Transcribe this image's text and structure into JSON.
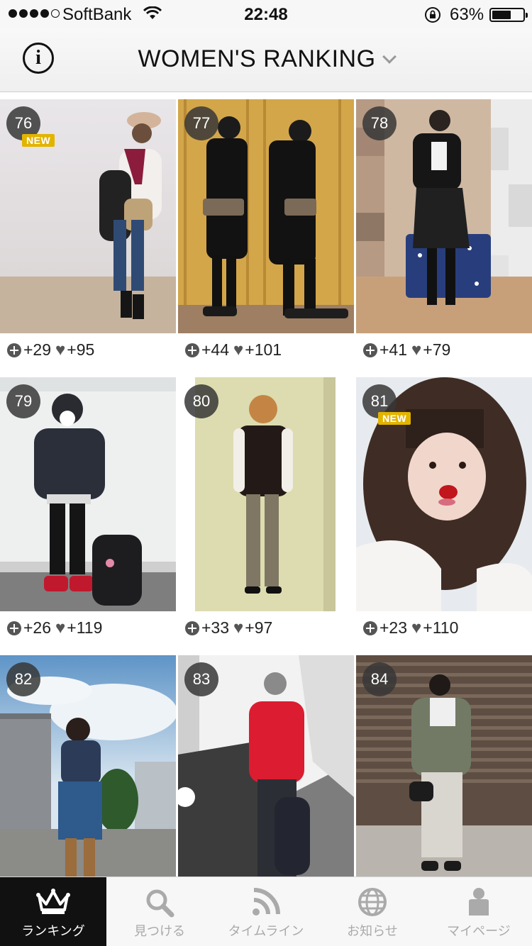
{
  "status_bar": {
    "carrier": "SoftBank",
    "time": "22:48",
    "battery": "63%",
    "battery_level": 0.63
  },
  "header": {
    "title": "WOMEN'S RANKING",
    "info_icon": "info-icon",
    "dropdown_icon": "chevron-down-icon"
  },
  "ranking": [
    {
      "rank": "76",
      "new": "NEW",
      "clips": "+29",
      "likes": "+95"
    },
    {
      "rank": "77",
      "new": "",
      "clips": "+44",
      "likes": "+101"
    },
    {
      "rank": "78",
      "new": "",
      "clips": "+41",
      "likes": "+79"
    },
    {
      "rank": "79",
      "new": "",
      "clips": "+26",
      "likes": "+119"
    },
    {
      "rank": "80",
      "new": "",
      "clips": "+33",
      "likes": "+97"
    },
    {
      "rank": "81",
      "new": "NEW",
      "clips": "+23",
      "likes": "+110"
    },
    {
      "rank": "82",
      "new": "",
      "clips": "",
      "likes": ""
    },
    {
      "rank": "83",
      "new": "",
      "clips": "",
      "likes": ""
    },
    {
      "rank": "84",
      "new": "",
      "clips": "",
      "likes": ""
    }
  ],
  "tabs": [
    {
      "label": "ランキング",
      "icon": "crown-icon",
      "active": true
    },
    {
      "label": "見つける",
      "icon": "search-icon",
      "active": false
    },
    {
      "label": "タイムライン",
      "icon": "rss-icon",
      "active": false
    },
    {
      "label": "お知らせ",
      "icon": "globe-icon",
      "active": false
    },
    {
      "label": "マイページ",
      "icon": "person-icon",
      "active": false
    }
  ]
}
